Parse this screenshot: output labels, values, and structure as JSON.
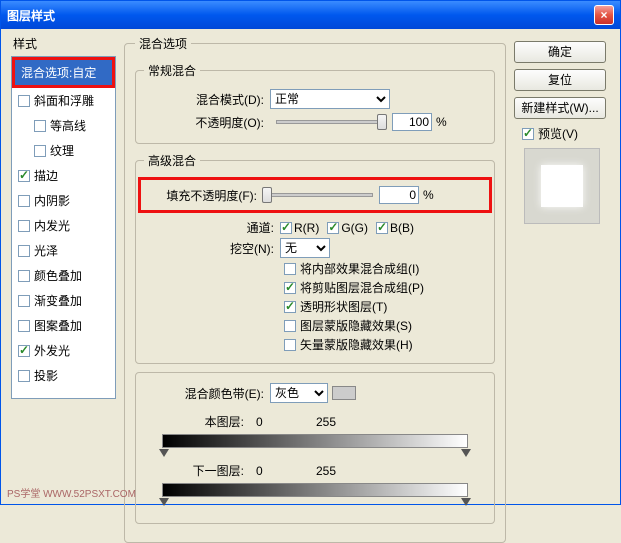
{
  "title": "图层样式",
  "left_label": "样式",
  "styles": [
    {
      "label": "混合选项:自定",
      "checked": null,
      "selected": true,
      "indent": false
    },
    {
      "label": "斜面和浮雕",
      "checked": false,
      "indent": false
    },
    {
      "label": "等高线",
      "checked": false,
      "indent": true
    },
    {
      "label": "纹理",
      "checked": false,
      "indent": true
    },
    {
      "label": "描边",
      "checked": true,
      "indent": false
    },
    {
      "label": "内阴影",
      "checked": false,
      "indent": false
    },
    {
      "label": "内发光",
      "checked": false,
      "indent": false
    },
    {
      "label": "光泽",
      "checked": false,
      "indent": false
    },
    {
      "label": "颜色叠加",
      "checked": false,
      "indent": false
    },
    {
      "label": "渐变叠加",
      "checked": false,
      "indent": false
    },
    {
      "label": "图案叠加",
      "checked": false,
      "indent": false
    },
    {
      "label": "外发光",
      "checked": true,
      "indent": false
    },
    {
      "label": "投影",
      "checked": false,
      "indent": false
    }
  ],
  "blend_options_title": "混合选项",
  "general_title": "常规混合",
  "blend_mode_label": "混合模式(D):",
  "blend_mode_value": "正常",
  "opacity_label": "不透明度(O):",
  "opacity_value": "100",
  "pct": "%",
  "advanced_title": "高级混合",
  "fill_opacity_label": "填充不透明度(F):",
  "fill_opacity_value": "0",
  "channels_label": "通道:",
  "chan_r": "R(R)",
  "chan_g": "G(G)",
  "chan_b": "B(B)",
  "knockout_label": "挖空(N):",
  "knockout_value": "无",
  "opts": [
    {
      "label": "将内部效果混合成组(I)",
      "checked": false
    },
    {
      "label": "将剪贴图层混合成组(P)",
      "checked": true
    },
    {
      "label": "透明形状图层(T)",
      "checked": true
    },
    {
      "label": "图层蒙版隐藏效果(S)",
      "checked": false
    },
    {
      "label": "矢量蒙版隐藏效果(H)",
      "checked": false
    }
  ],
  "blendif_label": "混合颜色带(E):",
  "blendif_value": "灰色",
  "this_layer_label": "本图层:",
  "this_layer_min": "0",
  "this_layer_max": "255",
  "under_layer_label": "下一图层:",
  "under_layer_min": "0",
  "under_layer_max": "255",
  "btn_ok": "确定",
  "btn_reset": "复位",
  "btn_newstyle": "新建样式(W)...",
  "preview_label": "预览(V)",
  "watermark": "PS学堂  WWW.52PSXT.COM"
}
